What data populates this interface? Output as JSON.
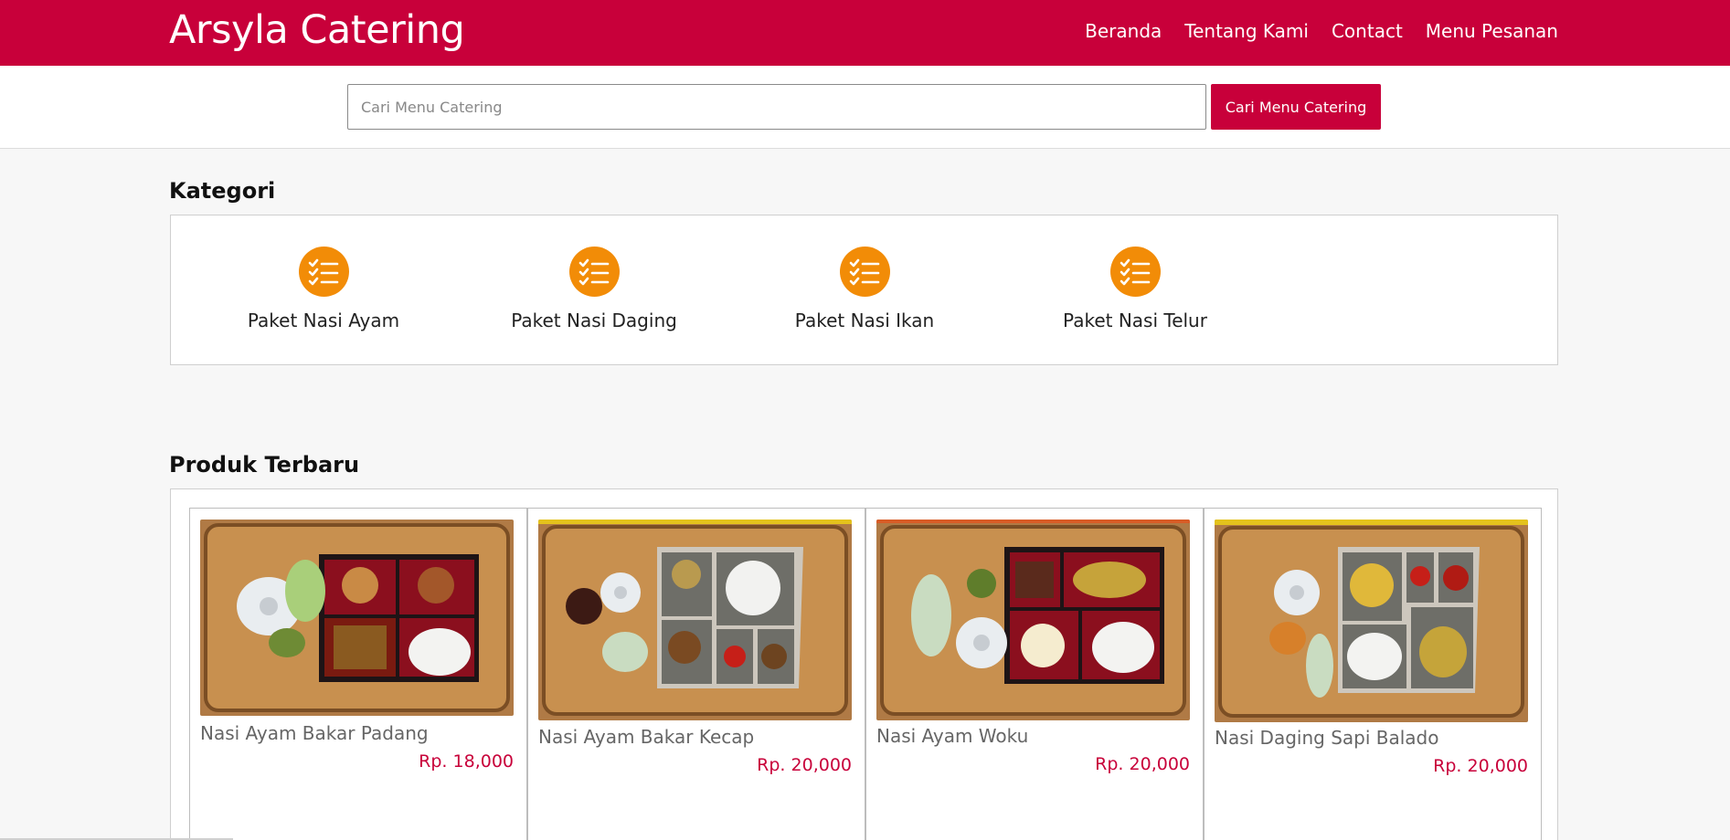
{
  "header": {
    "brand": "Arsyla Catering",
    "nav": [
      "Beranda",
      "Tentang Kami",
      "Contact",
      "Menu Pesanan"
    ]
  },
  "search": {
    "placeholder": "Cari Menu Catering",
    "value": "",
    "button_label": "Cari Menu Catering"
  },
  "kategori": {
    "title": "Kategori",
    "items": [
      {
        "label": "Paket Nasi Ayam",
        "icon": "checklist-icon"
      },
      {
        "label": "Paket Nasi Daging",
        "icon": "checklist-icon"
      },
      {
        "label": "Paket Nasi Ikan",
        "icon": "checklist-icon"
      },
      {
        "label": "Paket Nasi Telur",
        "icon": "checklist-icon"
      }
    ]
  },
  "produk": {
    "title": "Produk Terbaru",
    "items": [
      {
        "name": "Nasi Ayam Bakar Padang",
        "price": "Rp. 18,000"
      },
      {
        "name": "Nasi Ayam Bakar Kecap",
        "price": "Rp. 20,000"
      },
      {
        "name": "Nasi Ayam Woku",
        "price": "Rp. 20,000"
      },
      {
        "name": "Nasi Daging Sapi Balado",
        "price": "Rp. 20,000"
      }
    ]
  },
  "colors": {
    "brand": "#c8003a",
    "category_icon": "#f28c07",
    "price": "#c8003a"
  }
}
